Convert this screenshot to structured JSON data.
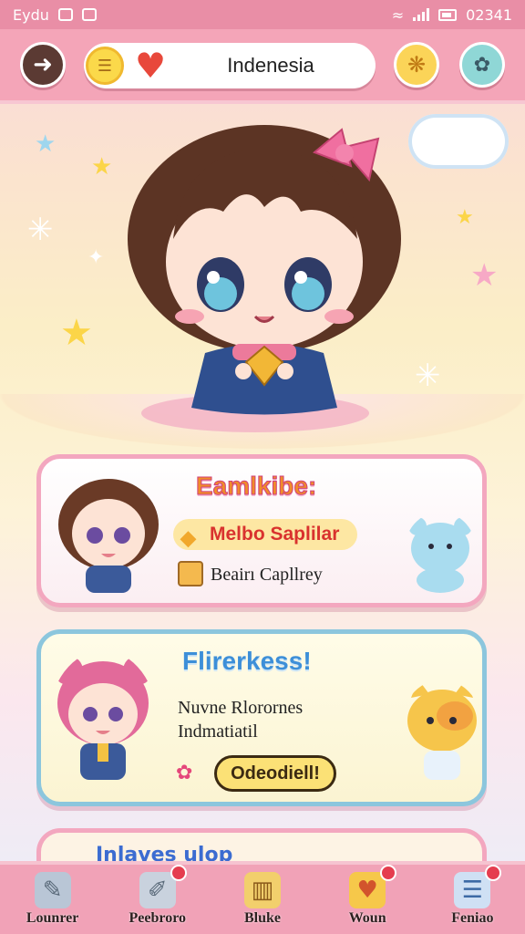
{
  "status_bar": {
    "left_text": "Eydu",
    "time": "02341"
  },
  "header": {
    "title": "Indenesia",
    "back_icon": "back-arrow-icon",
    "coin_icon": "coin-icon",
    "heart_icon": "heart-icon",
    "right_icons": [
      "paw-icon",
      "palette-icon"
    ]
  },
  "cards": [
    {
      "title": "Eamlkibe:",
      "highlight": "Melbo Saplilar",
      "line": "Beairı Capllrey"
    },
    {
      "title": "Flirerkess!",
      "text_line1": "Nuvne Rlorornes",
      "text_line2": "Indmatiatil",
      "button": "Odeodiell!"
    },
    {
      "title": "Inlaves ulop"
    }
  ],
  "tabs": [
    {
      "label": "Lounrer",
      "icon": "scroll-icon",
      "badge": false
    },
    {
      "label": "Peebroro",
      "icon": "note-icon",
      "badge": true
    },
    {
      "label": "Bluke",
      "icon": "basket-icon",
      "badge": false
    },
    {
      "label": "Woun",
      "icon": "heart-icon",
      "badge": true
    },
    {
      "label": "Feniao",
      "icon": "card-icon",
      "badge": true
    }
  ],
  "colors": {
    "primary_pink": "#f1a2b7",
    "accent_yellow": "#fbd458",
    "accent_blue": "#3d8fd8"
  }
}
